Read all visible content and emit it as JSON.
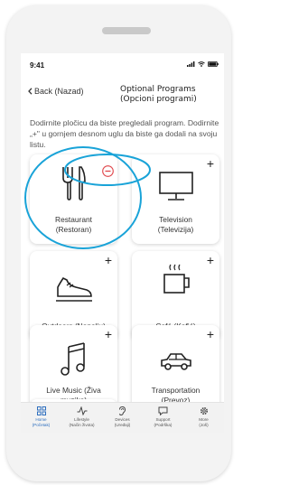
{
  "status": {
    "time": "9:41"
  },
  "nav": {
    "back_label": "Back (Nazad)",
    "title_line1": "Optional Programs",
    "title_line2": "(Opcioni programi)"
  },
  "intro_text": "Dodirnite pločicu da biste pregledali program. Dodirnite „+\" u gornjem desnom uglu da biste ga dodali na svoju listu.",
  "tiles": [
    {
      "label_line1": "Restaurant",
      "label_line2": "(Restoran)",
      "icon": "fork-knife-icon",
      "action": "remove"
    },
    {
      "label_line1": "Television",
      "label_line2": "(Televizija)",
      "icon": "tv-icon",
      "action": "add"
    },
    {
      "label_line1": "Outdoors (Napolju)",
      "label_line2": "",
      "icon": "shoe-icon",
      "action": "add"
    },
    {
      "label_line1": "Café (Kafić)",
      "label_line2": "",
      "icon": "coffee-cup-icon",
      "action": "add"
    },
    {
      "label_line1": "Live Music (Živa",
      "label_line2": "muzika)",
      "icon": "music-note-icon",
      "action": "add"
    },
    {
      "label_line1": "Transportation",
      "label_line2": "(Prevoz)",
      "icon": "car-icon",
      "action": "add"
    },
    {
      "label_line1": "",
      "label_line2": "",
      "icon": "",
      "action": "add"
    }
  ],
  "add_symbol": "+",
  "tabbar": [
    {
      "label_line1": "Home",
      "label_line2": "(Početak)",
      "icon": "grid-icon",
      "active": true
    },
    {
      "label_line1": "Lifestyle",
      "label_line2": "(Način života)",
      "icon": "pulse-icon",
      "active": false
    },
    {
      "label_line1": "Devices",
      "label_line2": "(Uređaji)",
      "icon": "ear-icon",
      "active": false
    },
    {
      "label_line1": "Support",
      "label_line2": "(Podrška)",
      "icon": "chat-icon",
      "active": false
    },
    {
      "label_line1": "More",
      "label_line2": "(Još)",
      "icon": "gear-icon",
      "active": false
    }
  ],
  "colors": {
    "accent": "#2e6fbf",
    "highlight": "#19a3d8",
    "remove": "#e0474c"
  }
}
